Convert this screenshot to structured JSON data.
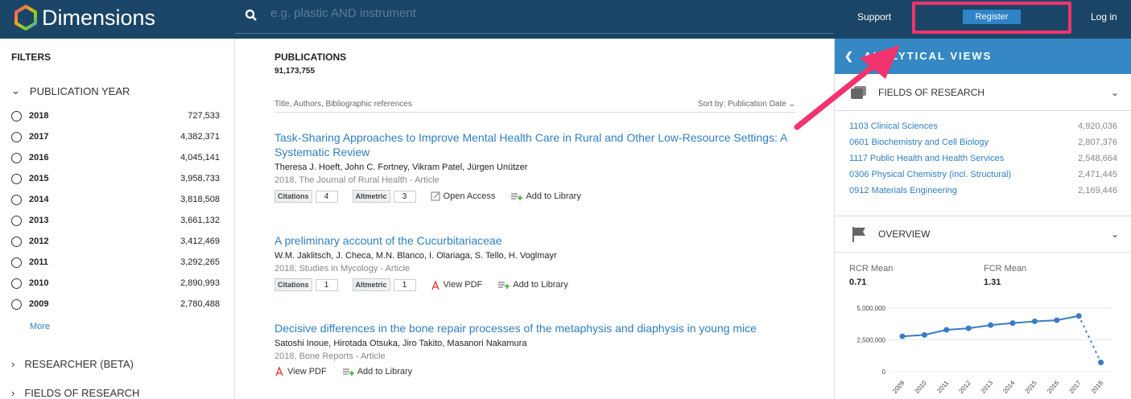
{
  "header": {
    "brand": "Dimensions",
    "search_placeholder": "e.g. plastic AND instrument",
    "support": "Support",
    "register": "Register",
    "login": "Log in"
  },
  "sidebar": {
    "title": "FILTERS",
    "publication_year": "PUBLICATION YEAR",
    "years": [
      {
        "year": "2018",
        "count": "727,533"
      },
      {
        "year": "2017",
        "count": "4,382,371"
      },
      {
        "year": "2016",
        "count": "4,045,141"
      },
      {
        "year": "2015",
        "count": "3,958,733"
      },
      {
        "year": "2014",
        "count": "3,818,508"
      },
      {
        "year": "2013",
        "count": "3,661,132"
      },
      {
        "year": "2012",
        "count": "3,412,469"
      },
      {
        "year": "2011",
        "count": "3,292,265"
      },
      {
        "year": "2010",
        "count": "2,890,993"
      },
      {
        "year": "2009",
        "count": "2,780,488"
      }
    ],
    "more": "More",
    "researcher": "RESEARCHER (BETA)",
    "fields": "FIELDS OF RESEARCH"
  },
  "main": {
    "title": "PUBLICATIONS",
    "count": "91,173,755",
    "sort_hint": "Title, Authors, Bibliographic references",
    "sort_by": "Sort by: Publication Date",
    "results": [
      {
        "title": "Task-Sharing Approaches to Improve Mental Health Care in Rural and Other Low-Resource Settings: A Systematic Review",
        "authors": "Theresa J. Hoeft, John C. Fortney, Vikram Patel, Jürgen Unützer",
        "meta": "2018, The Journal of Rural Health - Article",
        "citations": "4",
        "altmetric": "3",
        "action": "Open Access",
        "library": "Add to Library"
      },
      {
        "title": "A preliminary account of the Cucurbitariaceae",
        "authors": "W.M. Jaklitsch, J. Checa, M.N. Blanco, I. Olariaga, S. Tello, H. Voglmayr",
        "meta": "2018, Studies in Mycology - Article",
        "citations": "1",
        "altmetric": "1",
        "action": "View PDF",
        "library": "Add to Library"
      },
      {
        "title": "Decisive differences in the bone repair processes of the metaphysis and diaphysis in young mice",
        "authors": "Satoshi Inoue, Hirotada Otsuka, Jiro Takito, Masanori Nakamura",
        "meta": "2018, Bone Reports - Article",
        "action": "View PDF",
        "library": "Add to Library"
      }
    ],
    "citations_label": "Citations",
    "altmetric_label": "Altmetric"
  },
  "right": {
    "title": "ANALYTICAL VIEWS",
    "fields_title": "FIELDS OF RESEARCH",
    "fields": [
      {
        "name": "1103 Clinical Sciences",
        "value": "4,920,036"
      },
      {
        "name": "0601 Biochemistry and Cell Biology",
        "value": "2,807,376"
      },
      {
        "name": "1117 Public Health and Health Services",
        "value": "2,548,664"
      },
      {
        "name": "0306 Physical Chemistry (incl. Structural)",
        "value": "2,471,445"
      },
      {
        "name": "0912 Materials Engineering",
        "value": "2,169,446"
      }
    ],
    "overview_title": "OVERVIEW",
    "rcr_label": "RCR Mean",
    "rcr": "0.71",
    "fcr_label": "FCR Mean",
    "fcr": "1.31"
  },
  "chart_data": {
    "type": "line",
    "x": [
      "2009",
      "2010",
      "2011",
      "2012",
      "2013",
      "2014",
      "2015",
      "2016",
      "2017",
      "2018"
    ],
    "values": [
      2780488,
      2890993,
      3292265,
      3412469,
      3661132,
      3818508,
      3958733,
      4045141,
      4382371,
      727533
    ],
    "yticks": [
      "0",
      "2,500,000",
      "5,000,000"
    ],
    "ylim": [
      0,
      5000000
    ],
    "color": "#3a7cc4",
    "last_segment": "dotted"
  }
}
